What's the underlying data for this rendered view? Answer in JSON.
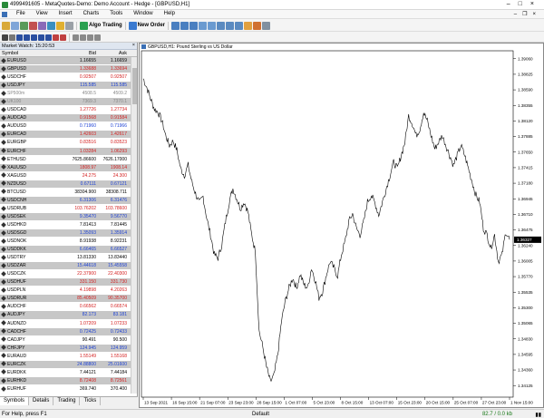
{
  "window": {
    "title": "4999491605 - MetaQuotes-Demo: Demo Account - Hedge - [GBPUSD,H1]"
  },
  "menu": [
    "File",
    "View",
    "Insert",
    "Charts",
    "Tools",
    "Window",
    "Help"
  ],
  "toolbar": {
    "algo_trading": "Algo Trading",
    "new_order": "New Order"
  },
  "market_watch": {
    "title": "Market Watch: 15:20:53",
    "columns": {
      "symbol": "Symbol",
      "bid": "Bid",
      "ask": "Ask"
    },
    "rows": [
      {
        "symbol": "EURUSD",
        "bid": "1.16655",
        "ask": "1.16659",
        "dir": "flat",
        "hl": true
      },
      {
        "symbol": "GBPUSD",
        "bid": "1.33688",
        "ask": "1.33694",
        "dir": "dn",
        "hl": true
      },
      {
        "symbol": "USDCHF",
        "bid": "0.92507",
        "ask": "0.92507",
        "dir": "dn",
        "hl": false
      },
      {
        "symbol": "USDJPY",
        "bid": "115.585",
        "ask": "115.585",
        "dir": "up",
        "hl": true
      },
      {
        "symbol": "SP500m",
        "bid": "4508.5",
        "ask": "4509.2",
        "dir": "flat",
        "hl": false,
        "dim": true
      },
      {
        "symbol": "UK100",
        "bid": "7369.3",
        "ask": "7370.1",
        "dir": "dn",
        "hl": true,
        "dim": true
      },
      {
        "symbol": "USDCAD",
        "bid": "1.27726",
        "ask": "1.27734",
        "dir": "dn",
        "hl": false
      },
      {
        "symbol": "AUDCAD",
        "bid": "0.91568",
        "ask": "0.91584",
        "dir": "dn",
        "hl": true
      },
      {
        "symbol": "AUDUSD",
        "bid": "0.71960",
        "ask": "0.71966",
        "dir": "up",
        "hl": false
      },
      {
        "symbol": "EURCAD",
        "bid": "1.42603",
        "ask": "1.42617",
        "dir": "dn",
        "hl": true
      },
      {
        "symbol": "EURGBP",
        "bid": "0.83516",
        "ask": "0.83523",
        "dir": "dn",
        "hl": false
      },
      {
        "symbol": "EURCHF",
        "bid": "1.03284",
        "ask": "1.06293",
        "dir": "dn",
        "hl": true
      },
      {
        "symbol": "ETHUSD",
        "bid": "7625.86600",
        "ask": "7626.17000",
        "dir": "flat",
        "hl": false
      },
      {
        "symbol": "XAUUSD",
        "bid": "1808.97",
        "ask": "1908.14",
        "dir": "dn",
        "hl": true
      },
      {
        "symbol": "XAGUSD",
        "bid": "24.275",
        "ask": "24.300",
        "dir": "dn",
        "hl": false
      },
      {
        "symbol": "NZDUSD",
        "bid": "0.67111",
        "ask": "0.67121",
        "dir": "up",
        "hl": true
      },
      {
        "symbol": "BTCUSD",
        "bid": "38304.900",
        "ask": "38308.711",
        "dir": "flat",
        "hl": false
      },
      {
        "symbol": "USDCNH",
        "bid": "6.31306",
        "ask": "6.31476",
        "dir": "up",
        "hl": true
      },
      {
        "symbol": "USDRUB",
        "bid": "103.76202",
        "ask": "103.78600",
        "dir": "dn",
        "hl": false
      },
      {
        "symbol": "USDSEK",
        "bid": "9.35470",
        "ask": "9.56770",
        "dir": "up",
        "hl": true
      },
      {
        "symbol": "USDHKD",
        "bid": "7.81413",
        "ask": "7.81445",
        "dir": "flat",
        "hl": false
      },
      {
        "symbol": "USDSGD",
        "bid": "1.35093",
        "ask": "1.35914",
        "dir": "up",
        "hl": true
      },
      {
        "symbol": "USDNOK",
        "bid": "8.91938",
        "ask": "8.92231",
        "dir": "flat",
        "hl": false
      },
      {
        "symbol": "USDDKK",
        "bid": "6.66465",
        "ask": "6.66527",
        "dir": "up",
        "hl": true
      },
      {
        "symbol": "USDTRY",
        "bid": "13.81330",
        "ask": "13.83440",
        "dir": "flat",
        "hl": false
      },
      {
        "symbol": "USDZAR",
        "bid": "15.44618",
        "ask": "15.45558",
        "dir": "up",
        "hl": true
      },
      {
        "symbol": "USDCZK",
        "bid": "22.37900",
        "ask": "22.40300",
        "dir": "dn",
        "hl": false
      },
      {
        "symbol": "USDHUF",
        "bid": "331.150",
        "ask": "331.730",
        "dir": "dn",
        "hl": true
      },
      {
        "symbol": "USDPLN",
        "bid": "4.19898",
        "ask": "4.20263",
        "dir": "dn",
        "hl": false
      },
      {
        "symbol": "USDRUR",
        "bid": "85.40509",
        "ask": "90.35700",
        "dir": "dn",
        "hl": true
      },
      {
        "symbol": "AUDCHF",
        "bid": "0.66562",
        "ask": "0.66574",
        "dir": "dn",
        "hl": false
      },
      {
        "symbol": "AUDJPY",
        "bid": "82.173",
        "ask": "83.181",
        "dir": "up",
        "hl": true
      },
      {
        "symbol": "AUDNZD",
        "bid": "1.07209",
        "ask": "1.07233",
        "dir": "dn",
        "hl": false
      },
      {
        "symbol": "CADCHF",
        "bid": "0.72425",
        "ask": "0.72433",
        "dir": "up",
        "hl": true
      },
      {
        "symbol": "CADJPY",
        "bid": "90.491",
        "ask": "90.500",
        "dir": "flat",
        "hl": false
      },
      {
        "symbol": "CHFJPY",
        "bid": "124.945",
        "ask": "124.959",
        "dir": "up",
        "hl": true
      },
      {
        "symbol": "EURAUD",
        "bid": "1.55149",
        "ask": "1.55168",
        "dir": "dn",
        "hl": false
      },
      {
        "symbol": "EURCZK",
        "bid": "24.88800",
        "ask": "25.01600",
        "dir": "up",
        "hl": true
      },
      {
        "symbol": "EURDKK",
        "bid": "7.44121",
        "ask": "7.44184",
        "dir": "flat",
        "hl": false
      },
      {
        "symbol": "EURHKD",
        "bid": "8.72408",
        "ask": "8.72561",
        "dir": "dn",
        "hl": true
      },
      {
        "symbol": "EURHUF",
        "bid": "369.740",
        "ask": "370.400",
        "dir": "flat",
        "hl": false
      }
    ],
    "tabs": [
      "Symbols",
      "Details",
      "Trading",
      "Ticks"
    ]
  },
  "chart_title": "GBPUSD,H1: Pound Sterling vs US Dollar",
  "chart_data": {
    "type": "line",
    "title": "GBPUSD,H1: Pound Sterling vs US Dollar",
    "xlabel": "",
    "ylabel": "",
    "x_ticks": [
      "13 Sep 2021",
      "16 Sep 15:00",
      "21 Sep 07:00",
      "23 Sep 23:00",
      "28 Sep 15:00",
      "1 Oct 07:00",
      "5 Oct 23:00",
      "8 Oct 15:00",
      "13 Oct 07:00",
      "15 Oct 23:00",
      "20 Oct 15:00",
      "25 Oct 07:00",
      "27 Oct 23:00",
      "1 Nov 15:00"
    ],
    "y_ticks": [
      "1.39060",
      "1.38825",
      "1.38590",
      "1.38355",
      "1.38120",
      "1.37885",
      "1.37650",
      "1.37415",
      "1.37180",
      "1.36945",
      "1.36710",
      "1.36475",
      "1.36240",
      "1.36005",
      "1.35770",
      "1.35535",
      "1.35300",
      "1.35065",
      "1.34830",
      "1.34595",
      "1.34360",
      "1.34125"
    ],
    "ylim": [
      1.3395,
      1.3918
    ],
    "current_price": "1.36327",
    "series": [
      {
        "values": [
          1.3876,
          1.3862,
          1.3845,
          1.383,
          1.3825,
          1.3812,
          1.379,
          1.3775,
          1.3782,
          1.3768,
          1.374,
          1.373,
          1.3745,
          1.372,
          1.3702,
          1.3688,
          1.3698,
          1.3665,
          1.364,
          1.361,
          1.3605,
          1.3625,
          1.366,
          1.369,
          1.371,
          1.3695,
          1.368,
          1.369,
          1.3675,
          1.364,
          1.3615,
          1.3495,
          1.347,
          1.344,
          1.3418,
          1.3428,
          1.346,
          1.351,
          1.354,
          1.356,
          1.3575,
          1.356,
          1.358,
          1.3565,
          1.356,
          1.359,
          1.3572,
          1.3545,
          1.3555,
          1.358,
          1.36,
          1.359,
          1.3578,
          1.361,
          1.363,
          1.366,
          1.3672,
          1.365,
          1.364,
          1.366,
          1.369,
          1.37,
          1.3688,
          1.367,
          1.369,
          1.371,
          1.373,
          1.375,
          1.374,
          1.376,
          1.378,
          1.382,
          1.3808,
          1.379,
          1.38,
          1.3825,
          1.3812,
          1.379,
          1.377,
          1.378,
          1.379,
          1.3775,
          1.376,
          1.3745,
          1.376,
          1.3775,
          1.376,
          1.374,
          1.372,
          1.37,
          1.369,
          1.365,
          1.364,
          1.362,
          1.364,
          1.36,
          1.361,
          1.3645,
          1.3633
        ]
      }
    ]
  },
  "status": {
    "help": "For Help, press F1",
    "profile": "Default",
    "connection": "82.7 / 0.0 kb"
  },
  "colors": {
    "up": "#1a3fd4",
    "down": "#d42020",
    "row_highlight": "#c7c7c7",
    "price_marker": "#000000"
  }
}
